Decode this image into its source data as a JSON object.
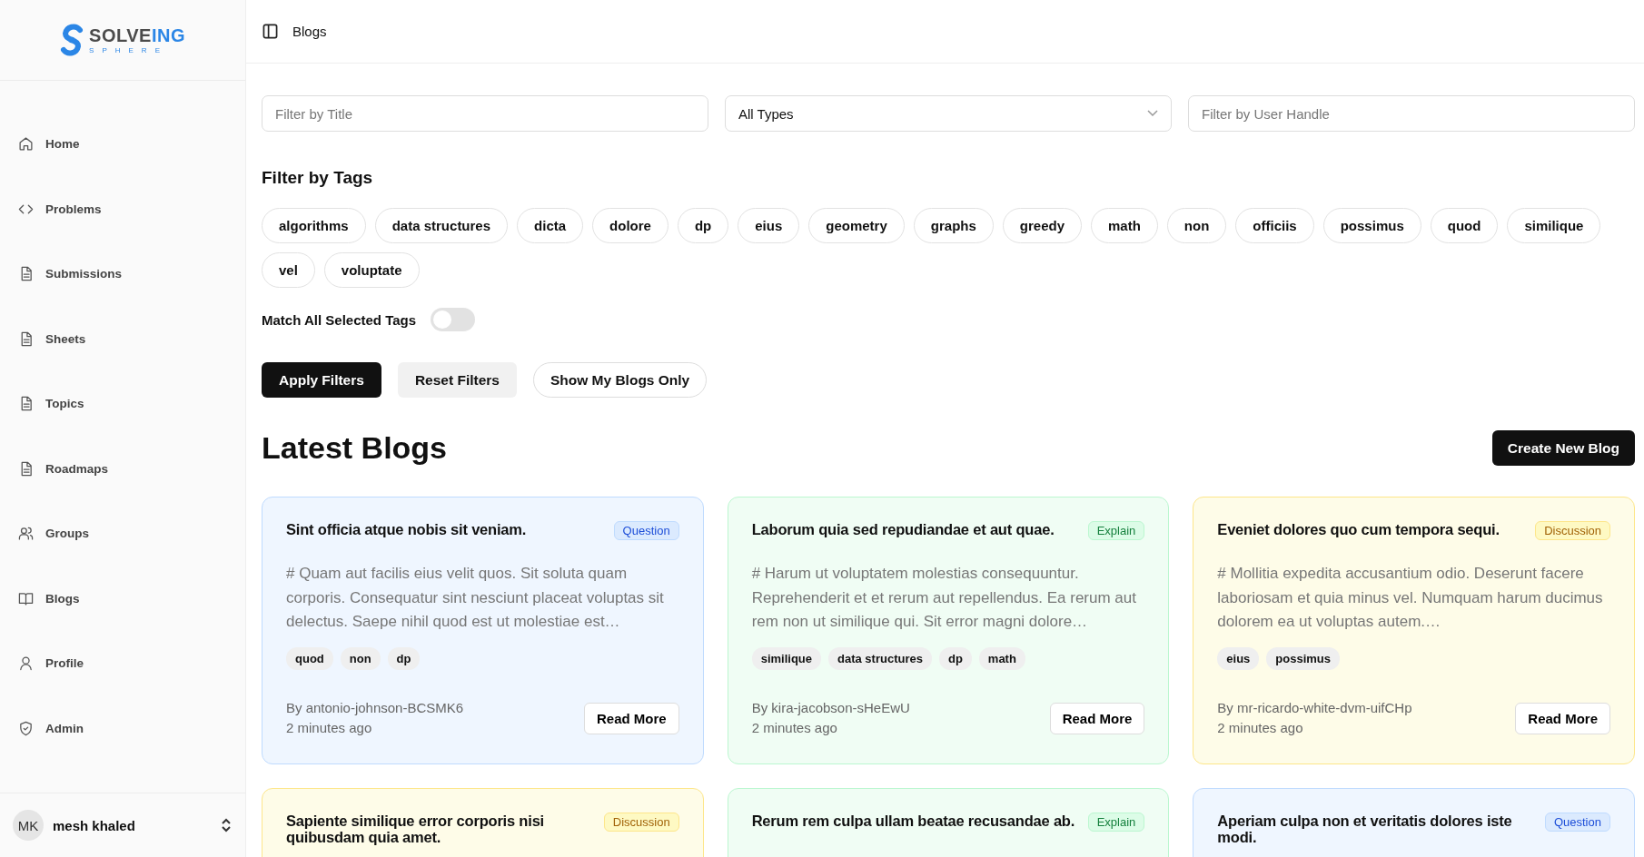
{
  "logo": {
    "word_a": "SOLVE",
    "word_b": "ING",
    "tagline": "SPHERE"
  },
  "sidebar": {
    "items": [
      {
        "label": "Home",
        "selected": false
      },
      {
        "label": "Problems",
        "selected": false
      },
      {
        "label": "Submissions",
        "selected": false
      },
      {
        "label": "Sheets",
        "selected": false
      },
      {
        "label": "Topics",
        "selected": false
      },
      {
        "label": "Roadmaps",
        "selected": false
      },
      {
        "label": "Groups",
        "selected": false
      },
      {
        "label": "Blogs",
        "selected": false
      },
      {
        "label": "Profile",
        "selected": false
      },
      {
        "label": "Admin",
        "selected": false
      }
    ],
    "user": {
      "initials": "MK",
      "name": "mesh khaled"
    }
  },
  "header": {
    "title": "Blogs"
  },
  "filters": {
    "title_field": {
      "placeholder": "Filter by Title"
    },
    "type_select": {
      "value": "All Types"
    },
    "handle_field": {
      "placeholder": "Filter by User Handle"
    }
  },
  "tags_heading": "Filter by Tags",
  "tags": [
    {
      "label": "algorithms",
      "selected": false
    },
    {
      "label": "data structures",
      "selected": false
    },
    {
      "label": "dicta",
      "selected": false
    },
    {
      "label": "dolore",
      "selected": false
    },
    {
      "label": "dp",
      "selected": false
    },
    {
      "label": "eius",
      "selected": false
    },
    {
      "label": "geometry",
      "selected": false
    },
    {
      "label": "graphs",
      "selected": false
    },
    {
      "label": "greedy",
      "selected": false
    },
    {
      "label": "math",
      "selected": false
    },
    {
      "label": "non",
      "selected": false
    },
    {
      "label": "officiis",
      "selected": false
    },
    {
      "label": "possimus",
      "selected": false
    },
    {
      "label": "quod",
      "selected": false
    },
    {
      "label": "similique",
      "selected": false
    },
    {
      "label": "vel",
      "selected": false
    },
    {
      "label": "voluptate",
      "selected": false
    }
  ],
  "match_all": {
    "label": "Match All Selected Tags",
    "on": false
  },
  "buttons": [
    {
      "label": "Apply Filters",
      "kind": "primary"
    },
    {
      "label": "Reset Filters",
      "kind": "secondary"
    },
    {
      "label": "Show My Blogs Only",
      "kind": "outline"
    }
  ],
  "section": {
    "title": "Latest Blogs",
    "create_button": "Create New Blog"
  },
  "blogs": [
    {
      "title": "Sint officia atque nobis sit veniam.",
      "kind": "question",
      "badge": "Question",
      "excerpt": "# Quam aut facilis eius velit quos. Sit soluta quam corporis. Consequatur sint nesciunt placeat voluptas sit delectus. Saepe nihil quod est ut molestiae est…",
      "tags": [
        "quod",
        "non",
        "dp"
      ],
      "author": "By antonio-johnson-BCSMK6",
      "time": "2 minutes ago",
      "action": "Read More"
    },
    {
      "title": "Laborum quia sed repudiandae et aut quae.",
      "kind": "explain",
      "badge": "Explain",
      "excerpt": "# Harum ut voluptatem molestias consequuntur. Reprehenderit et et rerum aut repellendus. Ea rerum aut rem non ut similique qui. Sit error magni dolore…",
      "tags": [
        "similique",
        "data structures",
        "dp",
        "math"
      ],
      "author": "By kira-jacobson-sHeEwU",
      "time": "2 minutes ago",
      "action": "Read More"
    },
    {
      "title": "Eveniet dolores quo cum tempora sequi.",
      "kind": "discussion",
      "badge": "Discussion",
      "excerpt": "# Mollitia expedita accusantium odio. Deserunt facere laboriosam et quia minus vel. Numquam harum ducimus dolorem ea ut voluptas autem.…",
      "tags": [
        "eius",
        "possimus"
      ],
      "author": "By mr-ricardo-white-dvm-uifCHp",
      "time": "2 minutes ago",
      "action": "Read More"
    },
    {
      "title": "Sapiente similique error corporis nisi quibusdam quia amet.",
      "kind": "discussion",
      "badge": "Discussion"
    },
    {
      "title": "Rerum rem culpa ullam beatae recusandae ab.",
      "kind": "explain",
      "badge": "Explain"
    },
    {
      "title": "Aperiam culpa non et veritatis dolores iste modi.",
      "kind": "question",
      "badge": "Question"
    }
  ]
}
